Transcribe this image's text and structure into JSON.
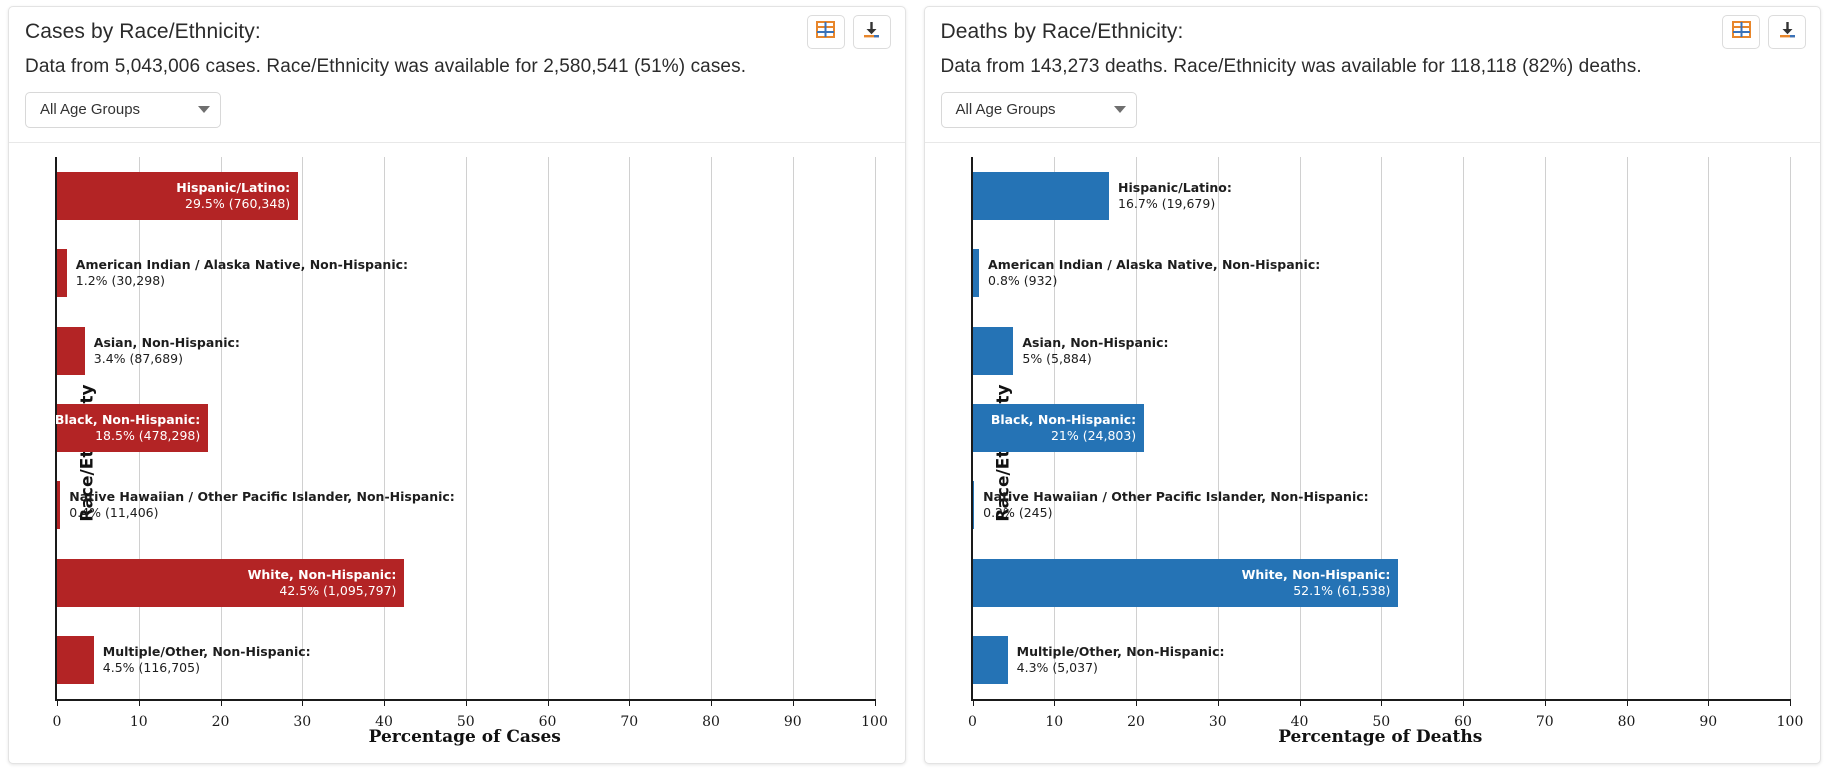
{
  "panels": [
    {
      "id": "cases",
      "title": "Cases by Race/Ethnicity:",
      "subtitle": "Data from 5,043,006 cases. Race/Ethnicity was available for 2,580,541 (51%) cases.",
      "age_filter": {
        "value": "All Age Groups",
        "options": [
          "All Age Groups"
        ]
      },
      "buttons": {
        "table_icon": "table-icon",
        "download_icon": "download-icon"
      },
      "accent": "#B32425"
    },
    {
      "id": "deaths",
      "title": "Deaths by Race/Ethnicity:",
      "subtitle": "Data from 143,273 deaths. Race/Ethnicity was available for 118,118 (82%) deaths.",
      "age_filter": {
        "value": "All Age Groups",
        "options": [
          "All Age Groups"
        ]
      },
      "buttons": {
        "table_icon": "table-icon",
        "download_icon": "download-icon"
      },
      "accent": "#2573B5"
    }
  ],
  "chart_data": [
    {
      "type": "bar",
      "orientation": "horizontal",
      "title": "Cases by Race/Ethnicity:",
      "xlabel": "Percentage of Cases",
      "ylabel": "Race/Ethnicity",
      "xlim": [
        0,
        100
      ],
      "xticks": [
        0,
        10,
        20,
        30,
        40,
        50,
        60,
        70,
        80,
        90,
        100
      ],
      "grid": true,
      "color": "#B32425",
      "categories": [
        "Hispanic/Latino",
        "American Indian / Alaska Native, Non-Hispanic",
        "Asian, Non-Hispanic",
        "Black, Non-Hispanic",
        "Native Hawaiian / Other Pacific Islander, Non-Hispanic",
        "White, Non-Hispanic",
        "Multiple/Other, Non-Hispanic"
      ],
      "values": [
        29.5,
        1.2,
        3.4,
        18.5,
        0.4,
        42.5,
        4.5
      ],
      "counts": [
        "760,348",
        "30,298",
        "87,689",
        "478,298",
        "11,406",
        "1,095,797",
        "116,705"
      ],
      "labels": [
        {
          "line1": "Hispanic/Latino:",
          "line2": "29.5% (760,348)",
          "inside": true
        },
        {
          "line1": "American Indian / Alaska Native, Non-Hispanic:",
          "line2": "1.2% (30,298)",
          "inside": false
        },
        {
          "line1": "Asian, Non-Hispanic:",
          "line2": "3.4% (87,689)",
          "inside": false
        },
        {
          "line1": "Black, Non-Hispanic:",
          "line2": "18.5% (478,298)",
          "inside": true
        },
        {
          "line1": "Native Hawaiian / Other Pacific Islander, Non-Hispanic:",
          "line2": "0.4% (11,406)",
          "inside": false
        },
        {
          "line1": "White, Non-Hispanic:",
          "line2": "42.5% (1,095,797)",
          "inside": true
        },
        {
          "line1": "Multiple/Other, Non-Hispanic:",
          "line2": "4.5% (116,705)",
          "inside": false
        }
      ]
    },
    {
      "type": "bar",
      "orientation": "horizontal",
      "title": "Deaths by Race/Ethnicity:",
      "xlabel": "Percentage of Deaths",
      "ylabel": "Race/Ethnicity",
      "xlim": [
        0,
        100
      ],
      "xticks": [
        0,
        10,
        20,
        30,
        40,
        50,
        60,
        70,
        80,
        90,
        100
      ],
      "grid": true,
      "color": "#2573B5",
      "categories": [
        "Hispanic/Latino",
        "American Indian / Alaska Native, Non-Hispanic",
        "Asian, Non-Hispanic",
        "Black, Non-Hispanic",
        "Native Hawaiian / Other Pacific Islander, Non-Hispanic",
        "White, Non-Hispanic",
        "Multiple/Other, Non-Hispanic"
      ],
      "values": [
        16.7,
        0.8,
        5.0,
        21.0,
        0.2,
        52.1,
        4.3
      ],
      "counts": [
        "19,679",
        "932",
        "5,884",
        "24,803",
        "245",
        "61,538",
        "5,037"
      ],
      "labels": [
        {
          "line1": "Hispanic/Latino:",
          "line2": "16.7% (19,679)",
          "inside": false
        },
        {
          "line1": "American Indian / Alaska Native, Non-Hispanic:",
          "line2": "0.8% (932)",
          "inside": false
        },
        {
          "line1": "Asian, Non-Hispanic:",
          "line2": "5% (5,884)",
          "inside": false
        },
        {
          "line1": "Black, Non-Hispanic:",
          "line2": "21% (24,803)",
          "inside": true
        },
        {
          "line1": "Native Hawaiian / Other Pacific Islander, Non-Hispanic:",
          "line2": "0.2% (245)",
          "inside": false
        },
        {
          "line1": "White, Non-Hispanic:",
          "line2": "52.1% (61,538)",
          "inside": true
        },
        {
          "line1": "Multiple/Other, Non-Hispanic:",
          "line2": "4.3% (5,037)",
          "inside": false
        }
      ]
    }
  ]
}
